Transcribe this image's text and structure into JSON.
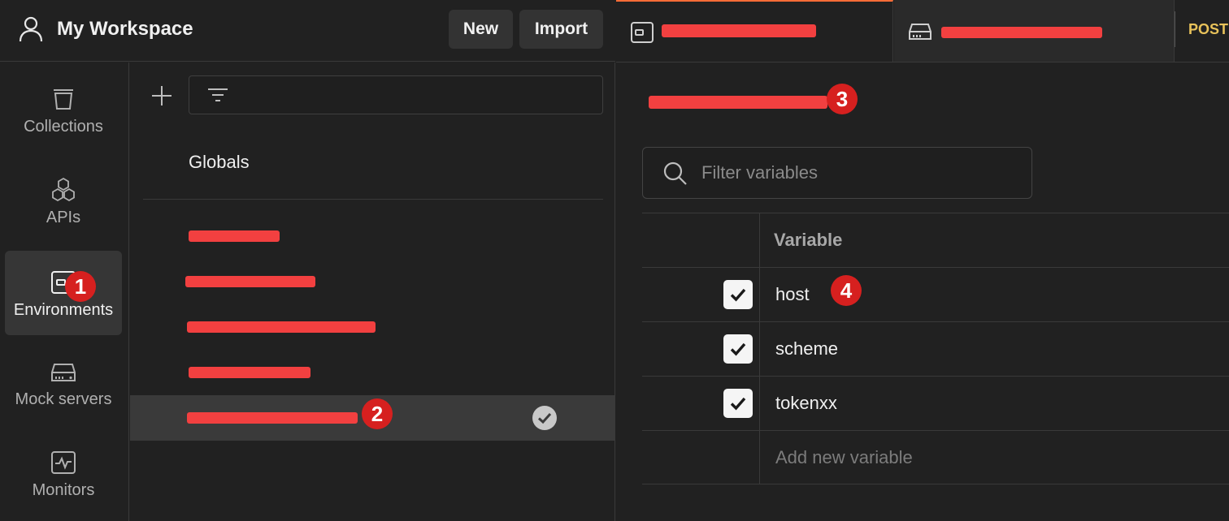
{
  "header": {
    "workspace_title": "My Workspace",
    "new_label": "New",
    "import_label": "Import"
  },
  "rail": {
    "items": [
      {
        "label": "Collections",
        "icon": "collections-icon"
      },
      {
        "label": "APIs",
        "icon": "apis-icon"
      },
      {
        "label": "Environments",
        "icon": "environments-icon",
        "active": true
      },
      {
        "label": "Mock servers",
        "icon": "mock-servers-icon"
      },
      {
        "label": "Monitors",
        "icon": "monitors-icon"
      }
    ]
  },
  "env_list": {
    "globals_label": "Globals",
    "selected_index": 4,
    "redacted_items": 5
  },
  "tabs": {
    "tab1_icon": "environment-icon",
    "tab2_icon": "mock-server-icon",
    "post_label": "POST"
  },
  "editor": {
    "search_placeholder": "Filter variables",
    "column_header": "Variable",
    "variables": [
      {
        "name": "host",
        "enabled": true
      },
      {
        "name": "scheme",
        "enabled": true
      },
      {
        "name": "tokenxx",
        "enabled": true
      }
    ],
    "add_placeholder": "Add new variable"
  },
  "annotations": {
    "badges": [
      "1",
      "2",
      "3",
      "4"
    ],
    "badge_color": "#d6201f",
    "redaction_color": "#f24040"
  },
  "colors": {
    "accent_tab": "#ff6c37",
    "post_method": "#e8c25a",
    "background": "#212121"
  }
}
